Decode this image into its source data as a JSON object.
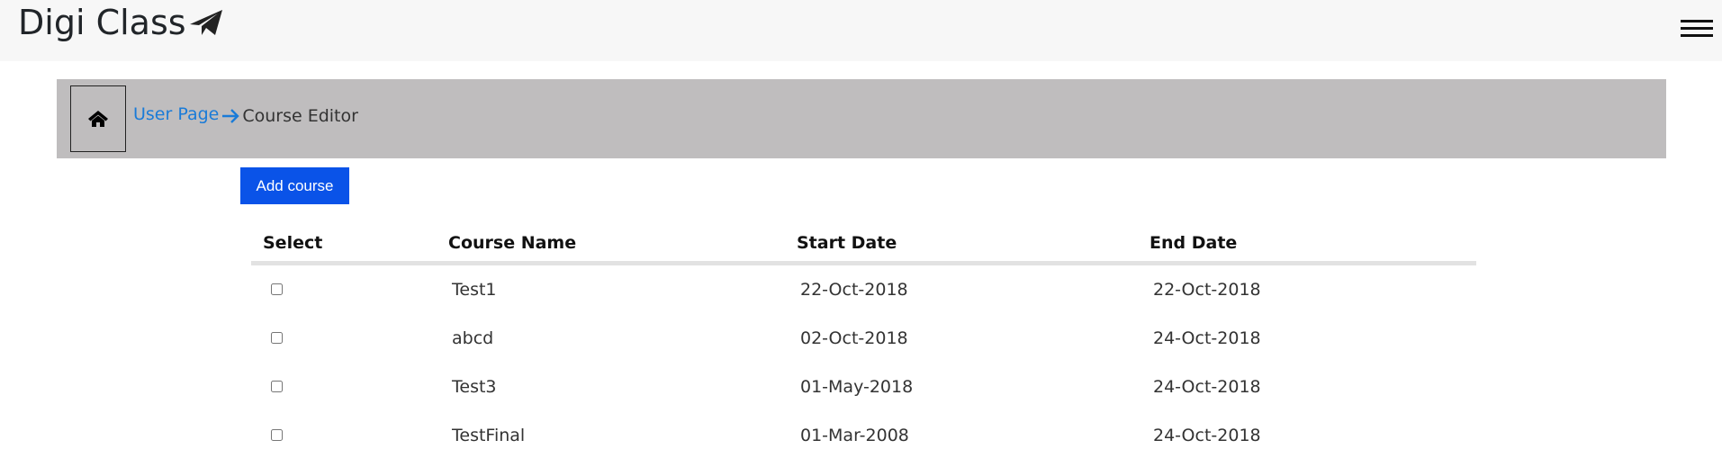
{
  "header": {
    "brand": "Digi Class",
    "brand_icon": "paper-plane-icon",
    "menu_icon": "hamburger-menu-icon"
  },
  "breadcrumb": {
    "home_icon": "home-icon",
    "link_label": "User Page",
    "separator_icon": "arrow-right-icon",
    "current_label": "Course Editor"
  },
  "toolbar": {
    "add_label": "Add course"
  },
  "table": {
    "headers": {
      "select": "Select",
      "name": "Course Name",
      "start": "Start Date",
      "end": "End Date"
    },
    "rows": [
      {
        "name": "Test1",
        "start": "22-Oct-2018",
        "end": "22-Oct-2018",
        "selected": false
      },
      {
        "name": "abcd",
        "start": "02-Oct-2018",
        "end": "24-Oct-2018",
        "selected": false
      },
      {
        "name": "Test3",
        "start": "01-May-2018",
        "end": "24-Oct-2018",
        "selected": false
      },
      {
        "name": "TestFinal",
        "start": "01-Mar-2008",
        "end": "24-Oct-2018",
        "selected": false
      }
    ]
  },
  "colors": {
    "topbar_bg": "#f7f7f7",
    "breadcrumb_bg": "#bfbdbe",
    "link": "#1a7bd8",
    "primary_button": "#0a53e8"
  }
}
